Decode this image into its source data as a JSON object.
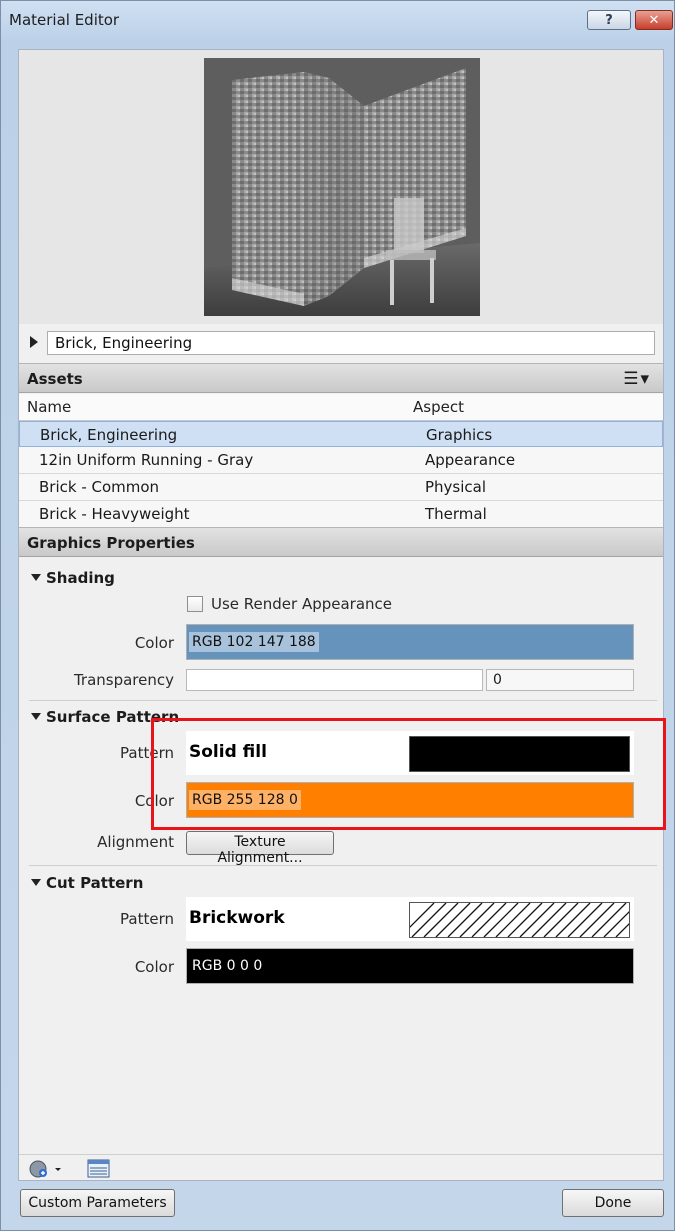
{
  "window": {
    "title": "Material Editor",
    "help_label": "?",
    "close_label": "✕"
  },
  "material": {
    "name": "Brick, Engineering"
  },
  "assets": {
    "header": "Assets",
    "columns": [
      "Name",
      "Aspect"
    ],
    "rows": [
      {
        "name": "Brick, Engineering",
        "aspect": "Graphics",
        "selected": true
      },
      {
        "name": "12in Uniform Running - Gray",
        "aspect": "Appearance",
        "selected": false
      },
      {
        "name": "Brick - Common",
        "aspect": "Physical",
        "selected": false
      },
      {
        "name": "Brick - Heavyweight",
        "aspect": "Thermal",
        "selected": false
      }
    ]
  },
  "graphics": {
    "header": "Graphics Properties",
    "shading": {
      "title": "Shading",
      "use_render_label": "Use Render Appearance",
      "color_label": "Color",
      "color_value": "RGB 102 147 188",
      "color_hex": "#6693bc",
      "transparency_label": "Transparency",
      "transparency_value": "0"
    },
    "surface_pattern": {
      "title": "Surface Pattern",
      "pattern_label": "Pattern",
      "pattern_value": "Solid fill",
      "color_label": "Color",
      "color_value": "RGB 255 128 0",
      "color_hex": "#ff8000",
      "alignment_label": "Alignment",
      "alignment_button": "Texture Alignment..."
    },
    "cut_pattern": {
      "title": "Cut Pattern",
      "pattern_label": "Pattern",
      "pattern_value": "Brickwork",
      "color_label": "Color",
      "color_value": "RGB 0 0 0",
      "color_hex": "#000000"
    }
  },
  "footer": {
    "custom_params": "Custom Parameters",
    "done": "Done"
  }
}
